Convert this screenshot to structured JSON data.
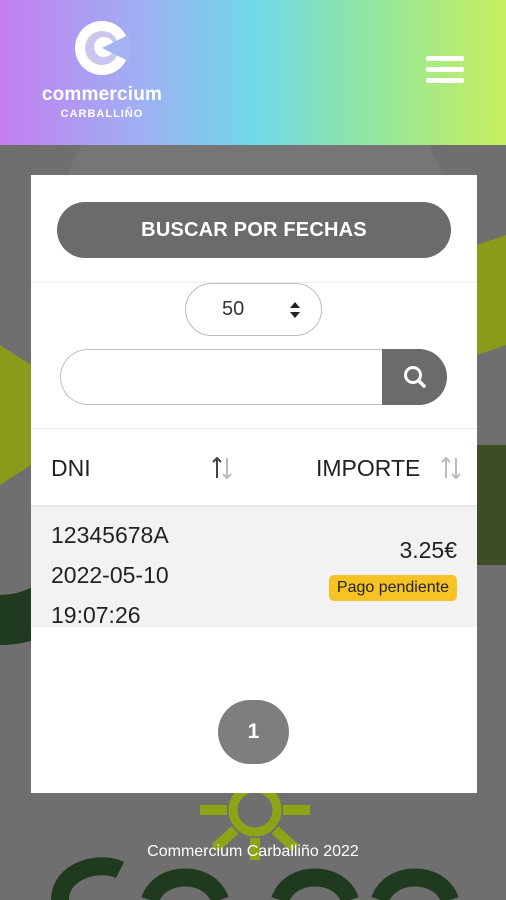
{
  "brand": {
    "name": "commercium",
    "subtitle": "CARBALLIÑO"
  },
  "header": {
    "menu_icon": "hamburger-menu-icon"
  },
  "filters": {
    "date_button_label": "BUSCAR POR FECHAS",
    "page_size_value": "50",
    "search_value": "",
    "search_icon": "search-icon"
  },
  "table": {
    "headers": {
      "dni": "DNI",
      "importe": "IMPORTE"
    },
    "rows": [
      {
        "dni": "12345678A",
        "date": "2022-05-10",
        "time": "19:07:26",
        "importe": "3.25€",
        "status": "Pago pendiente"
      }
    ]
  },
  "pagination": {
    "current_page": "1"
  },
  "footer": {
    "text": "Commercium Carballiño 2022"
  },
  "colors": {
    "gradient": [
      "#c37ef0",
      "#71d8ea",
      "#c8ee5e"
    ],
    "button_gray": "#6b6b6b",
    "badge_yellow": "#f7c225",
    "background_gray": "#6f6f6f"
  }
}
